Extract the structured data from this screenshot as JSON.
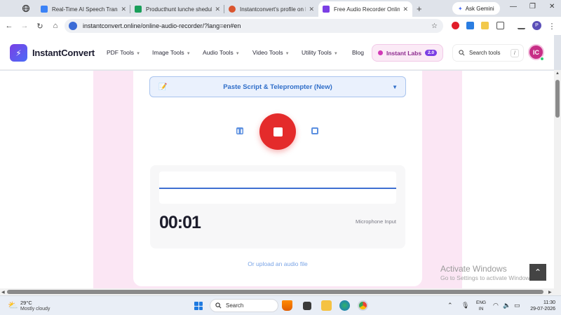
{
  "browser": {
    "tabs": [
      {
        "label": "Real-Time AI Speech Translator",
        "favicon_color": "#3b82f6"
      },
      {
        "label": "Producthunt lunche shedule -",
        "favicon_color": "#1a9e5a"
      },
      {
        "label": "Instantconvert's profile on Pr",
        "favicon_color": "#da552f"
      },
      {
        "label": "Free Audio Recorder Online",
        "favicon_color": "#7b3fe4"
      }
    ],
    "new_tab": "+",
    "gemini_label": "Ask Gemini",
    "url": "instantconvert.online/online-audio-recorder/?lang=en#en"
  },
  "site": {
    "logo_text": "InstantConvert",
    "nav": [
      "PDF Tools",
      "Image Tools",
      "Audio Tools",
      "Video Tools",
      "Utility Tools",
      "Blog"
    ],
    "labs_label": "Instant Labs",
    "labs_badge": "2.0",
    "search_placeholder": "Search tools",
    "search_shortcut": "/",
    "avatar_initials": "IC"
  },
  "recorder": {
    "teleprompter_label": "Paste Script & Teleprompter (New)",
    "timer": "00:01",
    "mic_label": "Microphone Input",
    "upload_link": "Or upload an audio file"
  },
  "watermark": {
    "title": "Activate Windows",
    "subtitle": "Go to Settings to activate Windows."
  },
  "taskbar": {
    "temp": "29°C",
    "weather": "Mostly cloudy",
    "search": "Search",
    "lang_top": "ENG",
    "lang_bottom": "IN",
    "time": "11:30",
    "date": "29-07-2026"
  },
  "colors": {
    "accent": "#7b3fe4",
    "record": "#e42b2b",
    "link": "#2f6ec9"
  }
}
